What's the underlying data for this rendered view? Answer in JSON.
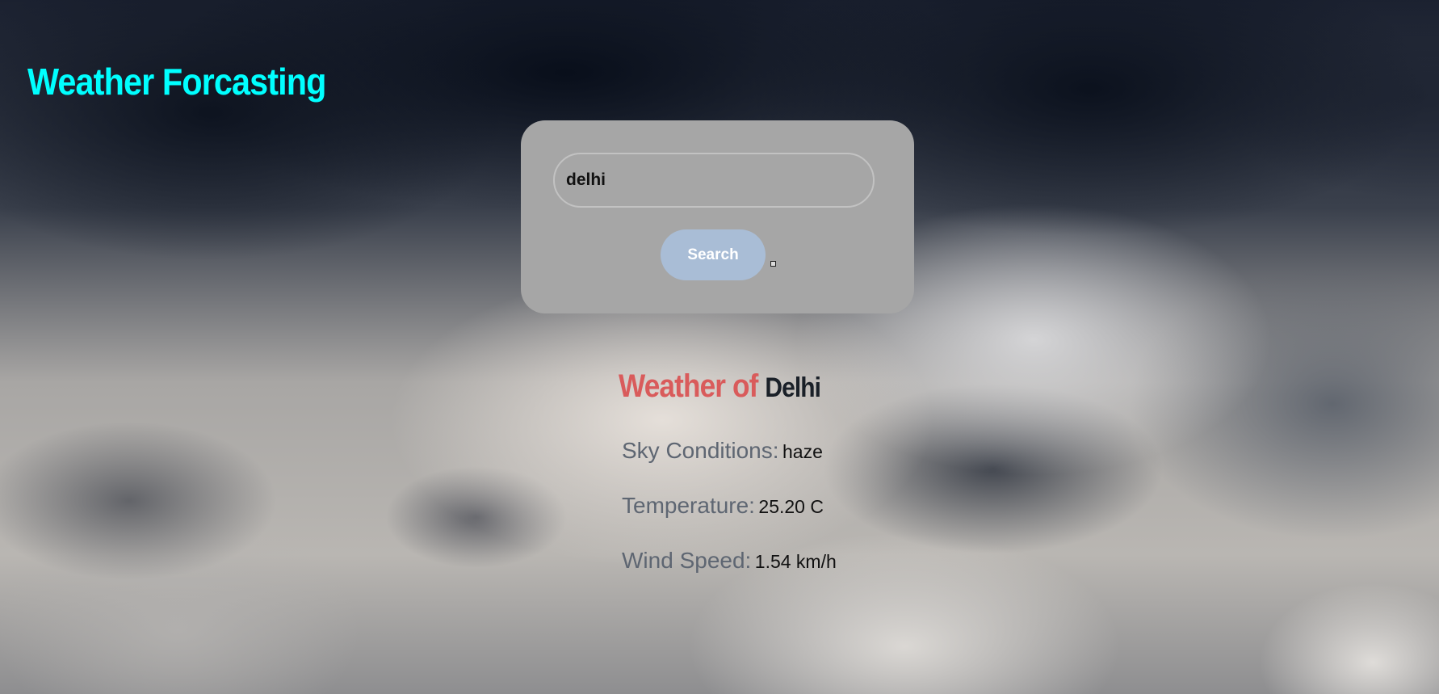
{
  "header": {
    "title": "Weather Forcasting"
  },
  "search": {
    "value": "delhi",
    "button_label": "Search"
  },
  "result": {
    "heading_prefix": "Weather of",
    "city": "Delhi",
    "sky_label": "Sky Conditions:",
    "sky_value": "haze",
    "temp_label": "Temperature:",
    "temp_value": "25.20 C",
    "wind_label": "Wind Speed:",
    "wind_value": "1.54 km/h"
  },
  "colors": {
    "title": "#00ffff",
    "card": "#a6a6a6",
    "button": "#a9bdd6",
    "heading_prefix": "#d95b5b",
    "label": "#5e6672"
  }
}
